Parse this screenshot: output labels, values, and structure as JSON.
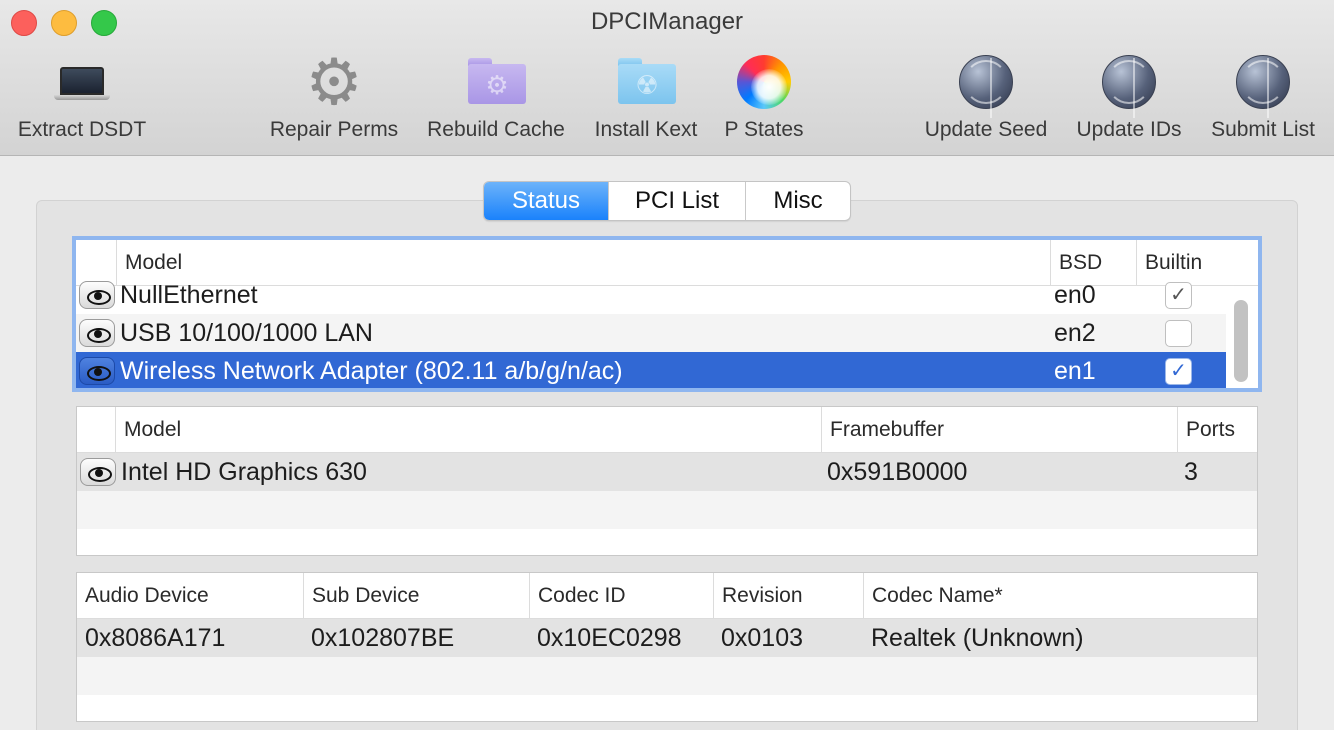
{
  "window": {
    "title": "DPCIManager"
  },
  "toolbar": {
    "items": [
      {
        "label": "Extract DSDT",
        "icon": "laptop-icon"
      },
      {
        "label": "Repair Perms",
        "icon": "gear-icon"
      },
      {
        "label": "Rebuild Cache",
        "icon": "folder-gear-icon"
      },
      {
        "label": "Install Kext",
        "icon": "folder-radiation-icon"
      },
      {
        "label": "P States",
        "icon": "color-wheel-icon"
      },
      {
        "label": "Update Seed",
        "icon": "globe-icon"
      },
      {
        "label": "Update IDs",
        "icon": "globe-icon"
      },
      {
        "label": "Submit List",
        "icon": "globe-icon"
      }
    ]
  },
  "tabs": {
    "items": [
      "Status",
      "PCI List",
      "Misc"
    ],
    "selected": "Status"
  },
  "network_table": {
    "columns": [
      "Model",
      "BSD",
      "Builtin"
    ],
    "rows": [
      {
        "model": "NullEthernet",
        "bsd": "en0",
        "builtin": "✓"
      },
      {
        "model": "USB 10/100/1000 LAN",
        "bsd": "en2",
        "builtin": ""
      },
      {
        "model": "Wireless Network Adapter (802.11 a/b/g/n/ac)",
        "bsd": "en1",
        "builtin": "✓"
      }
    ]
  },
  "graphics_table": {
    "columns": [
      "Model",
      "Framebuffer",
      "Ports"
    ],
    "rows": [
      {
        "model": "Intel HD Graphics 630",
        "framebuffer": "0x591B0000",
        "ports": "3"
      }
    ]
  },
  "audio_table": {
    "columns": [
      "Audio Device",
      "Sub Device",
      "Codec ID",
      "Revision",
      "Codec Name*"
    ],
    "rows": [
      {
        "audio_device": "0x8086A171",
        "sub_device": "0x102807BE",
        "codec_id": "0x10EC0298",
        "revision": "0x0103",
        "codec_name": "Realtek (Unknown)"
      }
    ]
  },
  "colors": {
    "selection": "#3168d4",
    "segment_active": "#1a82fb",
    "focus_ring": "#8fb6ef"
  }
}
